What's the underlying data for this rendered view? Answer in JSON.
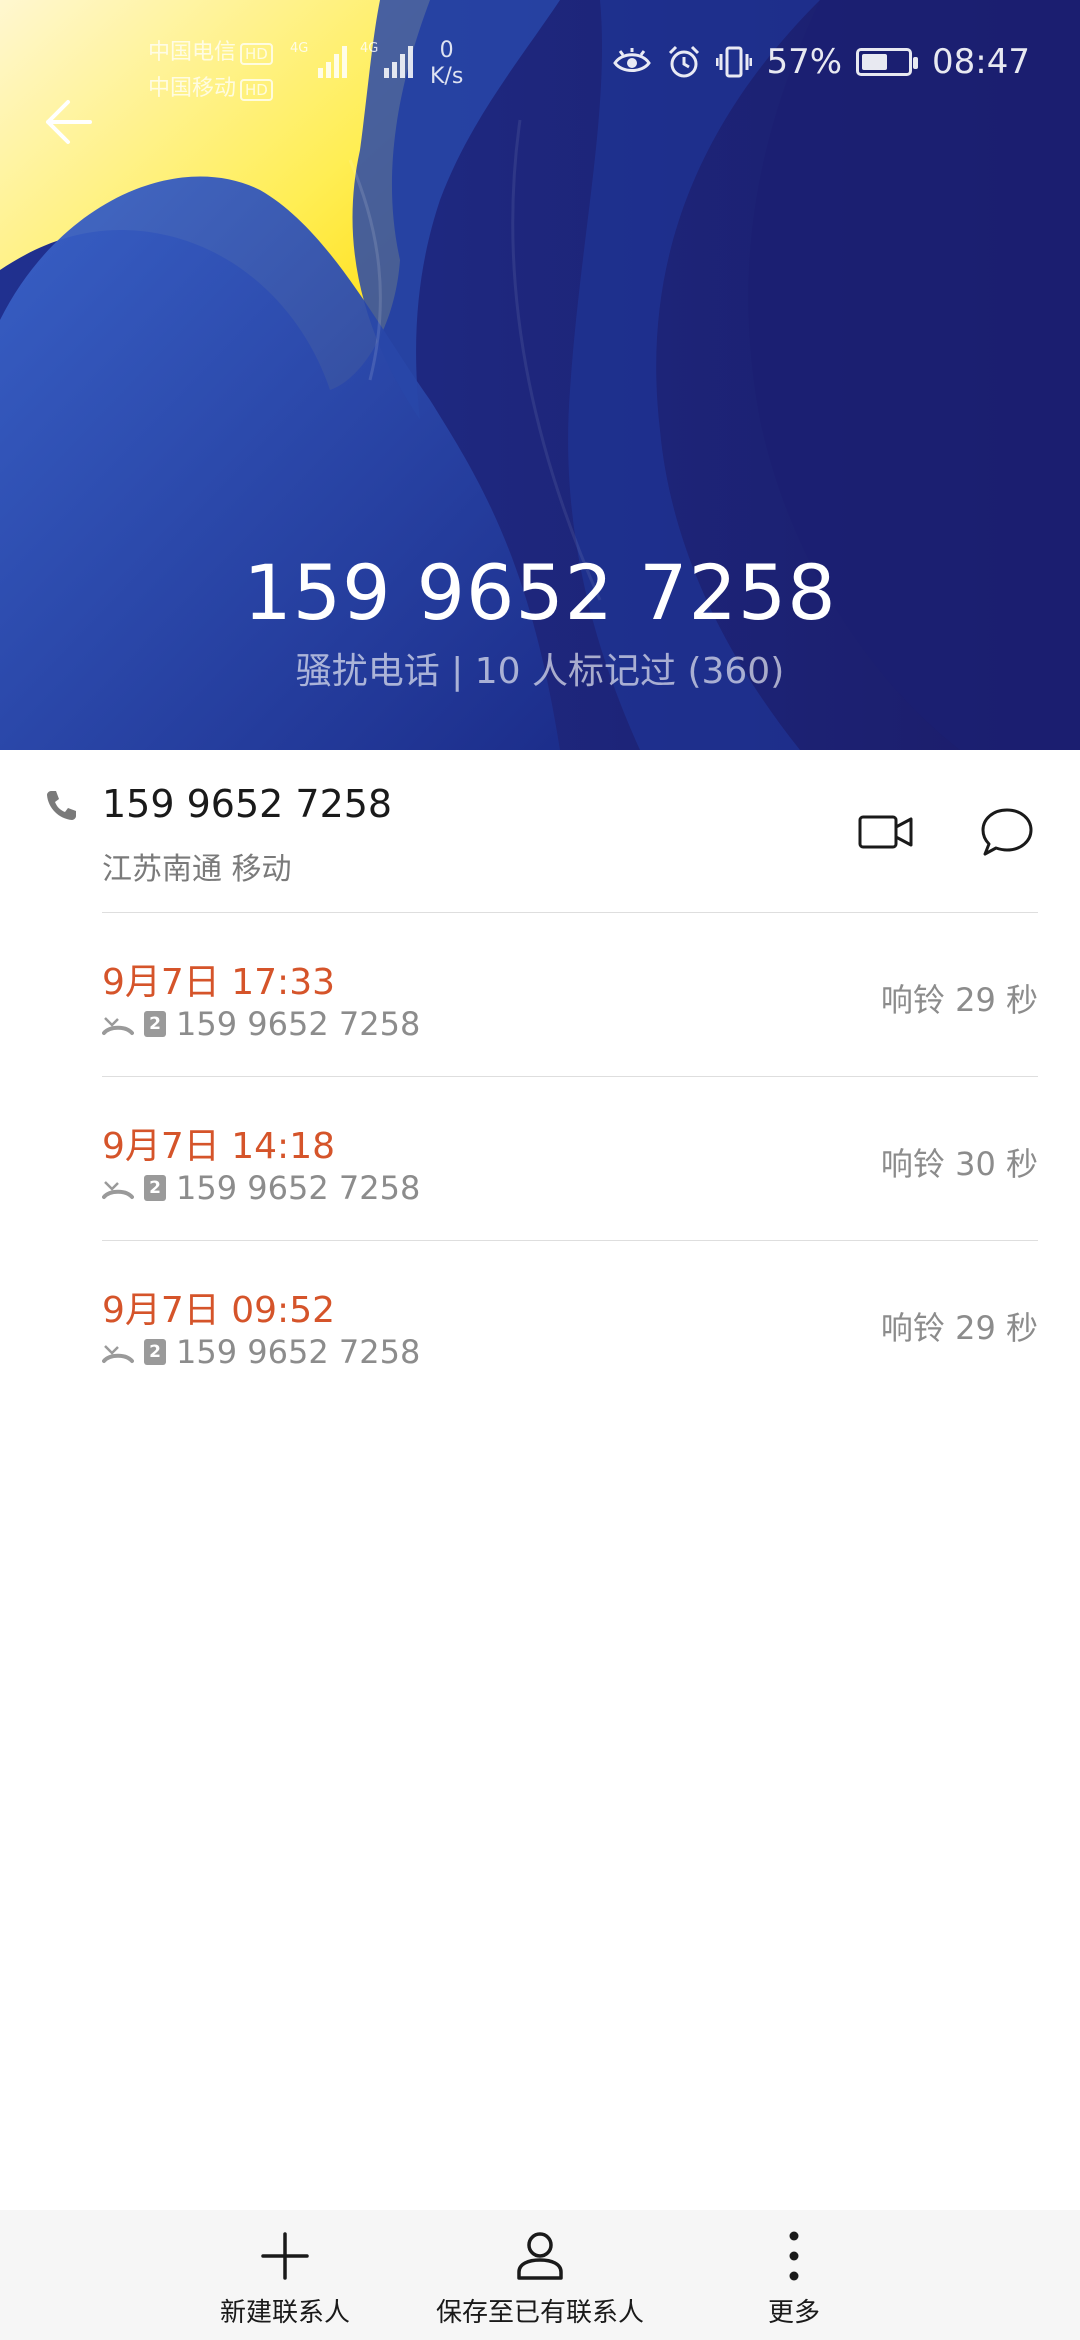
{
  "status_bar": {
    "carrier_1": "中国电信",
    "carrier_2": "中国移动",
    "hd_label": "HD",
    "net_4g_label": "4G",
    "speed_value": "0",
    "speed_unit": "K/s",
    "battery_text": "57%",
    "battery_level": 0.57,
    "time": "08:47",
    "icons": [
      "eye-comfort-icon",
      "alarm-icon",
      "vibrate-icon",
      "battery-icon"
    ]
  },
  "header": {
    "back_icon": "arrow-left-icon",
    "number": "159 9652 7258",
    "tag": "骚扰电话 | 10 人标记过 (360)"
  },
  "number_row": {
    "icon": "phone-icon",
    "number": "159 9652 7258",
    "location": "江苏南通 移动",
    "actions": [
      "video-call-icon",
      "message-icon"
    ]
  },
  "call_records": [
    {
      "time": "9月7日 17:33",
      "sim": "2",
      "number": "159 9652 7258",
      "ring": "响铃 29 秒",
      "icon": "missed-call-icon"
    },
    {
      "time": "9月7日 14:18",
      "sim": "2",
      "number": "159 9652 7258",
      "ring": "响铃 30 秒",
      "icon": "missed-call-icon"
    },
    {
      "time": "9月7日 09:52",
      "sim": "2",
      "number": "159 9652 7258",
      "ring": "响铃 29 秒",
      "icon": "missed-call-icon"
    }
  ],
  "bottom_bar": {
    "new_contact": "新建联系人",
    "save_existing": "保存至已有联系人",
    "more": "更多"
  },
  "colors": {
    "accent_time": "#d5542a",
    "header_dark": "#1a1f6e",
    "header_yellow": "#ffe100"
  }
}
